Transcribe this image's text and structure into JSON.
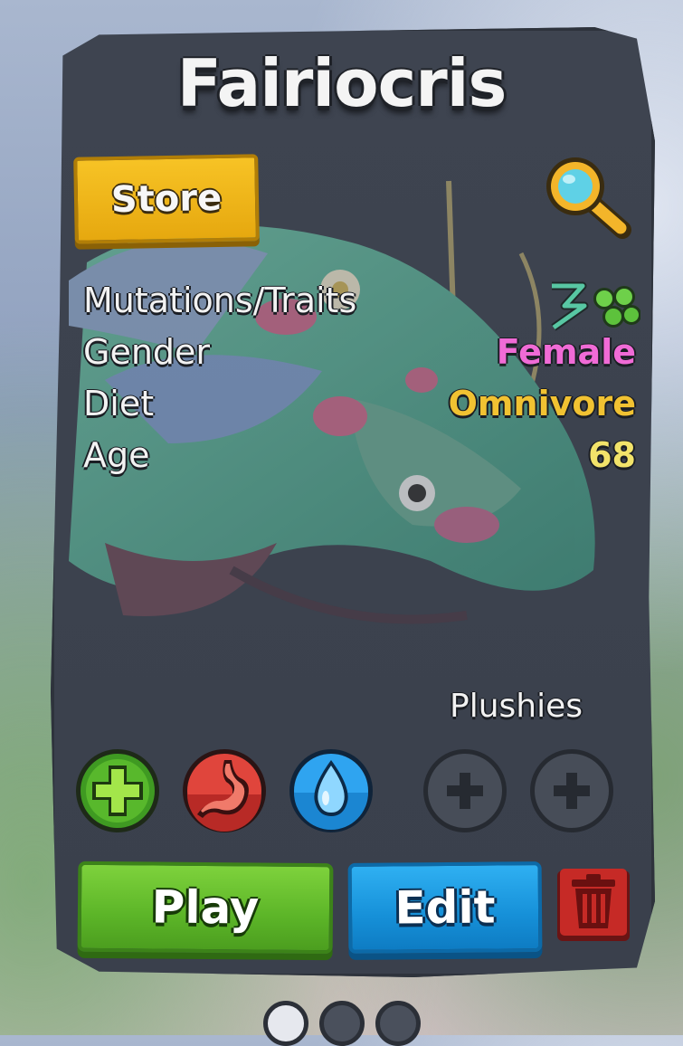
{
  "creature": {
    "name": "Fairiocris"
  },
  "store_button": {
    "label": "Store"
  },
  "stats": [
    {
      "label": "Mutations/Traits",
      "value": "",
      "icons": [
        "mutation-helix-icon",
        "green-cluster-icon"
      ]
    },
    {
      "label": "Gender",
      "value": "Female",
      "color": "#f06bd6"
    },
    {
      "label": "Diet",
      "value": "Omnivore",
      "color": "#f1c232"
    },
    {
      "label": "Age",
      "value": "68",
      "color": "#f2e36a"
    }
  ],
  "needs": [
    {
      "name": "health",
      "icon": "plus-icon",
      "color": "#4caf2a"
    },
    {
      "name": "hunger",
      "icon": "stomach-icon",
      "color": "#d83a32"
    },
    {
      "name": "thirst",
      "icon": "water-drop-icon",
      "color": "#2196e8"
    }
  ],
  "plushies": {
    "label": "Plushies",
    "slots": 2
  },
  "actions": {
    "play_label": "Play",
    "edit_label": "Edit"
  },
  "pagination": {
    "count": 3
  }
}
